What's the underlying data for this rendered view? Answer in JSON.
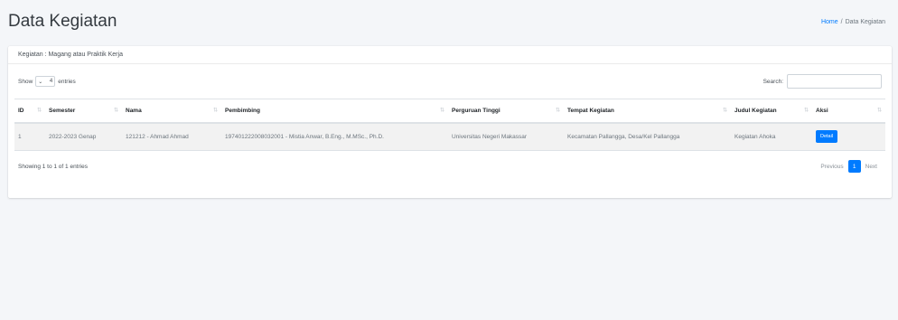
{
  "page": {
    "title": "Data Kegiatan",
    "breadcrumb": {
      "home": "Home",
      "separator": "/",
      "current": "Data Kegiatan"
    }
  },
  "card": {
    "header": "Kegiatan : Magang atau Praktik Kerja"
  },
  "table_controls": {
    "show_label": "Show",
    "entries_value": "4",
    "entries_label": "entries",
    "search_label": "Search:",
    "search_value": ""
  },
  "table": {
    "columns": [
      "ID",
      "Semester",
      "Nama",
      "Pembimbing",
      "Perguruan Tinggi",
      "Tempat Kegiatan",
      "Judul Kegiatan",
      "Aksi"
    ],
    "rows": [
      {
        "id": "1",
        "semester": "2022-2023 Genap",
        "nama": "121212 - Ahmad Ahmad",
        "pembimbing": "197401222008032001 - Mistia Anwar, B.Eng., M.MSc., Ph.D.",
        "perguruan_tinggi": "Universitas Negeri Makassar",
        "tempat_kegiatan": "Kecamatan Pallangga, Desa/Kel Pallangga",
        "judul_kegiatan": "Kegiatan Ahoka",
        "aksi": "Detail"
      }
    ]
  },
  "footer": {
    "info": "Showing 1 to 1 of 1 entries",
    "previous": "Previous",
    "current_page": "1",
    "next": "Next"
  },
  "colors": {
    "accent": "#007bff",
    "background": "#f4f6f9",
    "card": "#ffffff",
    "row_stripe": "#f2f2f2"
  },
  "icons": {
    "sort": "sort-arrows-icon",
    "dropdown": "chevron-down-icon"
  }
}
